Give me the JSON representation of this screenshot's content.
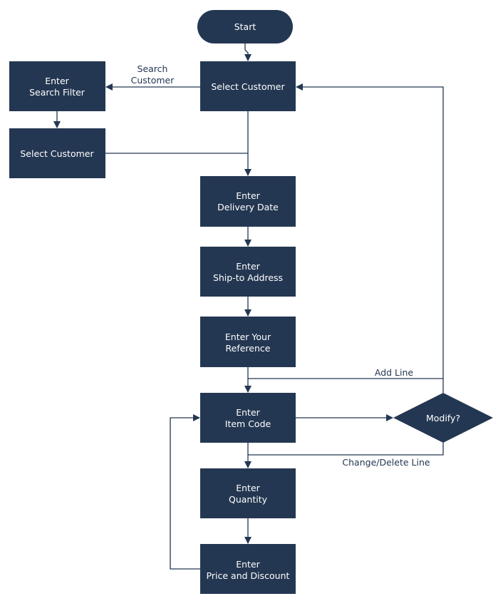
{
  "diagram": {
    "colors": {
      "node_fill": "#243752",
      "node_text": "#ffffff",
      "edge": "#243752"
    },
    "nodes": {
      "start": {
        "shape": "terminator",
        "lines": [
          "Start"
        ]
      },
      "select_customer": {
        "shape": "process",
        "lines": [
          "Select Customer"
        ]
      },
      "enter_search_filter": {
        "shape": "process",
        "lines": [
          "Enter",
          "Search Filter"
        ]
      },
      "select_customer_filtered": {
        "shape": "process",
        "lines": [
          "Select Customer"
        ]
      },
      "enter_delivery_date": {
        "shape": "process",
        "lines": [
          "Enter",
          "Delivery Date"
        ]
      },
      "enter_ship_to": {
        "shape": "process",
        "lines": [
          "Enter",
          "Ship-to Address"
        ]
      },
      "enter_your_reference": {
        "shape": "process",
        "lines": [
          "Enter Your",
          "Reference"
        ]
      },
      "enter_item_code": {
        "shape": "process",
        "lines": [
          "Enter",
          "Item Code"
        ]
      },
      "modify": {
        "shape": "decision",
        "lines": [
          "Modify?"
        ]
      },
      "enter_quantity": {
        "shape": "process",
        "lines": [
          "Enter",
          "Quantity"
        ]
      },
      "enter_price_discount": {
        "shape": "process",
        "lines": [
          "Enter",
          "Price and Discount"
        ]
      }
    },
    "edges": {
      "search_customer": {
        "from": "select_customer",
        "to": "enter_search_filter",
        "label": [
          "Search",
          "Customer"
        ]
      },
      "add_line": {
        "from": "modify",
        "to": "enter_item_code",
        "label": "Add Line"
      },
      "change_delete_line": {
        "from": "modify",
        "to": "enter_quantity",
        "label": "Change/Delete Line"
      }
    }
  }
}
